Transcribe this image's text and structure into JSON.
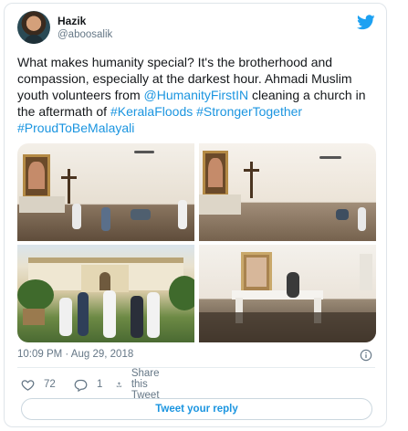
{
  "author": {
    "name": "Hazik",
    "handle": "@aboosalik"
  },
  "tweet": {
    "text_plain_1": "What makes humanity special? It's the brotherhood and compassion, especially at the darkest hour. Ahmadi Muslim youth volunteers from ",
    "mention": "@HumanityFirstIN",
    "text_plain_2": " cleaning a church in the aftermath of ",
    "hashtag_1": "#KeralaFloods",
    "hashtag_2": "#StrongerTogether",
    "hashtag_3": "#ProudToBeMalayali"
  },
  "timestamp": "10:09 PM · Aug 29, 2018",
  "actions": {
    "like_count": "72",
    "reply_count": "1",
    "share_label": "Share this Tweet"
  },
  "reply_button_label": "Tweet your reply",
  "colors": {
    "link": "#1b95e0",
    "muted": "#657786",
    "text": "#14171a",
    "border": "#dfe5ea"
  },
  "icons": [
    "twitter-bird-icon",
    "info-icon",
    "heart-icon",
    "reply-icon",
    "share-icon"
  ]
}
